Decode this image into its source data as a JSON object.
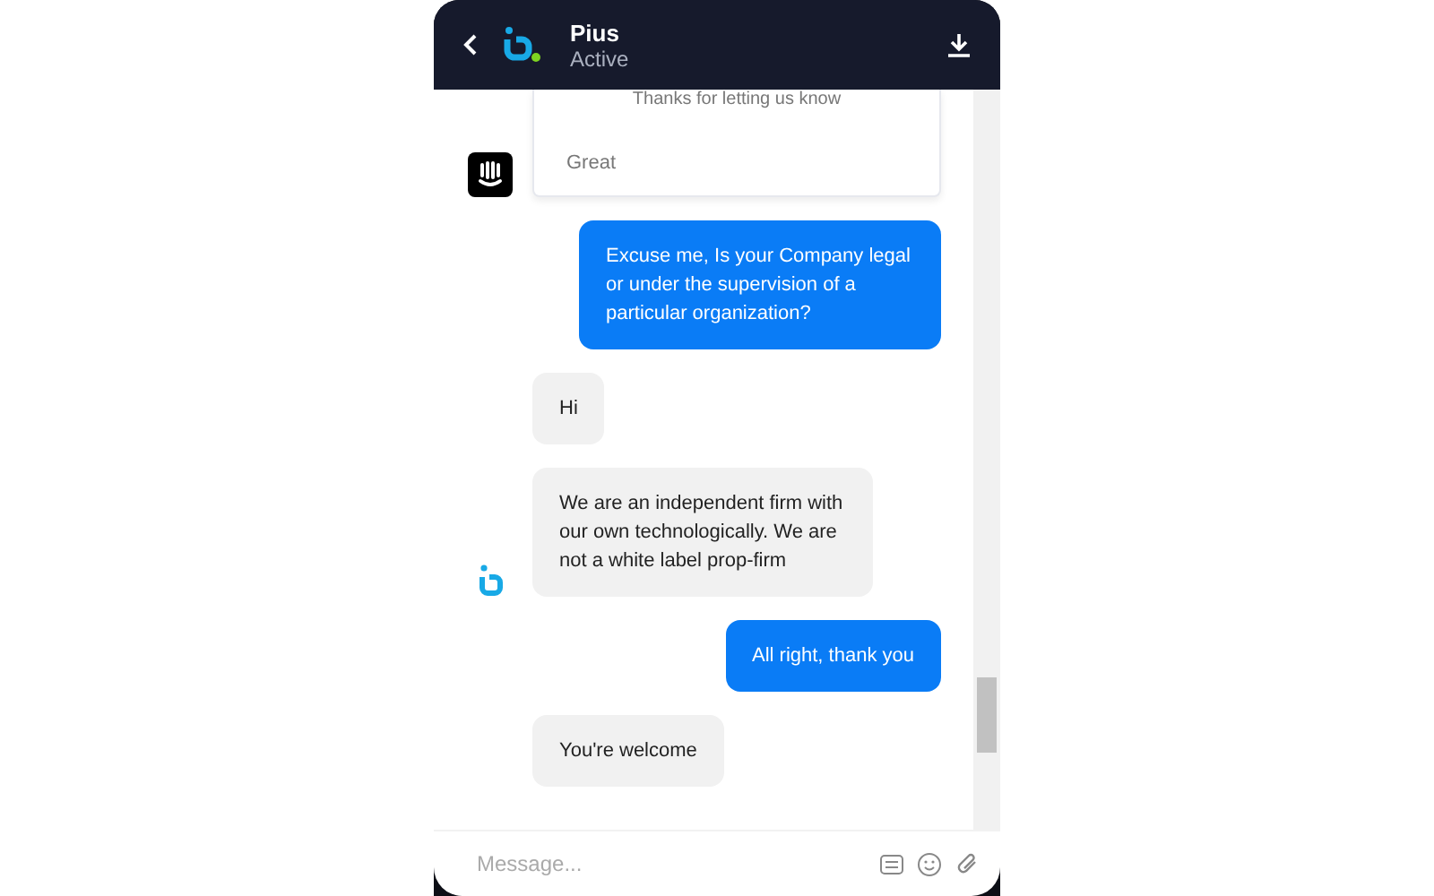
{
  "header": {
    "name": "Pius",
    "status": "Active"
  },
  "messages": [
    {
      "kind": "card",
      "text": "Thanks for letting us know",
      "reply": "Great",
      "avatar": true
    },
    {
      "kind": "user",
      "text": "Excuse me, Is your Company legal or under the supervision of a particular organization?"
    },
    {
      "kind": "agent",
      "text": "Hi"
    },
    {
      "kind": "agent",
      "text": "We are an independent firm with our own technologically. We are not a white label prop-firm",
      "avatar": true
    },
    {
      "kind": "user",
      "text": "All right, thank you"
    },
    {
      "kind": "agent",
      "text": "You're welcome"
    }
  ],
  "composer": {
    "placeholder": "Message..."
  }
}
